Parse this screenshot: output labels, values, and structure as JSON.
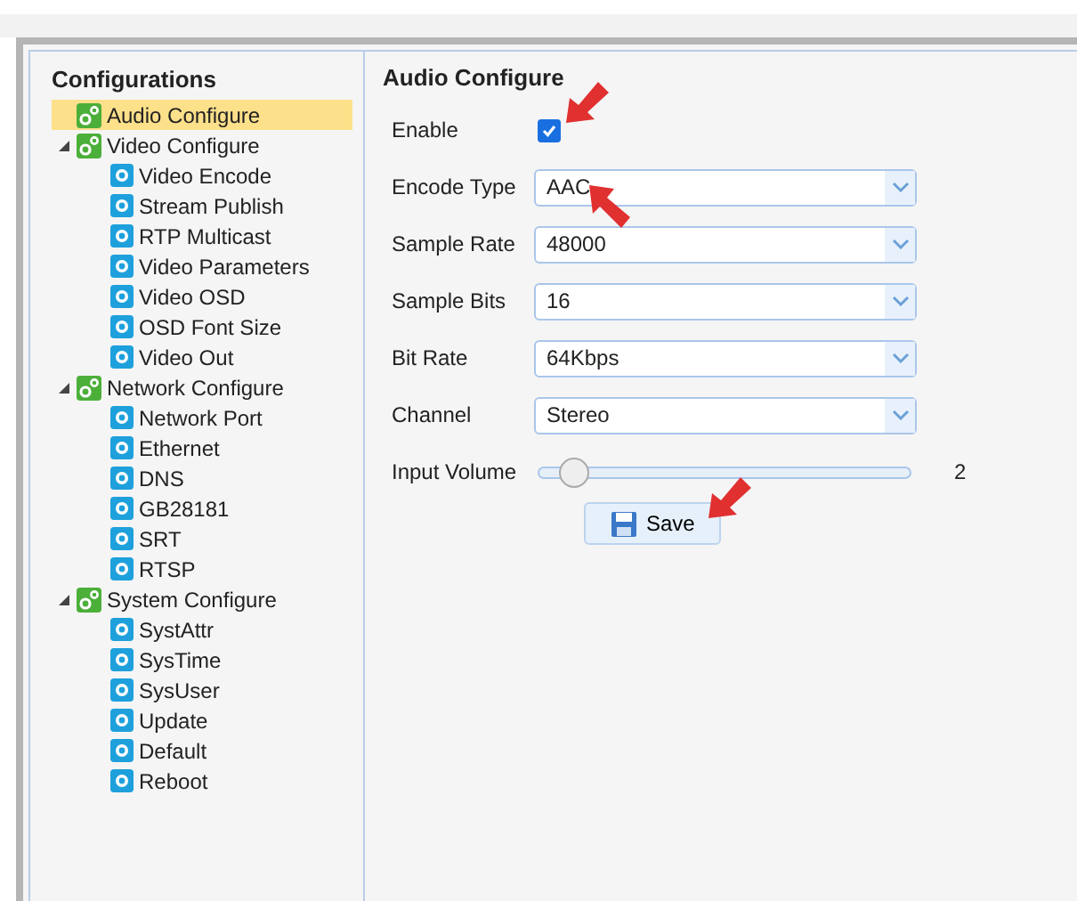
{
  "sidebar": {
    "title": "Configurations",
    "items": [
      {
        "label": "Audio Configure",
        "selected": true
      },
      {
        "label": "Video Configure",
        "selected": false,
        "expanded": true,
        "children": [
          {
            "label": "Video Encode",
            "selected": false
          },
          {
            "label": "Stream Publish",
            "selected": false
          },
          {
            "label": "RTP Multicast",
            "selected": false
          },
          {
            "label": "Video Parameters",
            "selected": false
          },
          {
            "label": "Video OSD",
            "selected": false
          },
          {
            "label": "OSD Font Size",
            "selected": false
          },
          {
            "label": "Video Out",
            "selected": false
          }
        ]
      },
      {
        "label": "Network Configure",
        "selected": false,
        "expanded": true,
        "children": [
          {
            "label": "Network Port",
            "selected": false
          },
          {
            "label": "Ethernet",
            "selected": false
          },
          {
            "label": "DNS",
            "selected": false
          },
          {
            "label": "GB28181",
            "selected": false
          },
          {
            "label": "SRT",
            "selected": false
          },
          {
            "label": "RTSP",
            "selected": false
          }
        ]
      },
      {
        "label": "System Configure",
        "selected": false,
        "expanded": true,
        "children": [
          {
            "label": "SystAttr",
            "selected": false
          },
          {
            "label": "SysTime",
            "selected": false
          },
          {
            "label": "SysUser",
            "selected": false
          },
          {
            "label": "Update",
            "selected": false
          },
          {
            "label": "Default",
            "selected": false
          },
          {
            "label": "Reboot",
            "selected": false
          }
        ]
      }
    ]
  },
  "panel": {
    "title": "Audio Configure",
    "fields": [
      {
        "kind": "checkbox",
        "label": "Enable",
        "checked": true
      },
      {
        "kind": "select",
        "label": "Encode Type",
        "value": "AAC"
      },
      {
        "kind": "select",
        "label": "Sample Rate",
        "value": "48000"
      },
      {
        "kind": "select",
        "label": "Sample Bits",
        "value": "16"
      },
      {
        "kind": "select",
        "label": "Bit Rate",
        "value": "64Kbps"
      },
      {
        "kind": "select",
        "label": "Channel",
        "value": "Stereo"
      },
      {
        "kind": "slider",
        "label": "Input Volume",
        "level": 0.1,
        "reading": "2"
      }
    ],
    "save_button": "Save"
  }
}
